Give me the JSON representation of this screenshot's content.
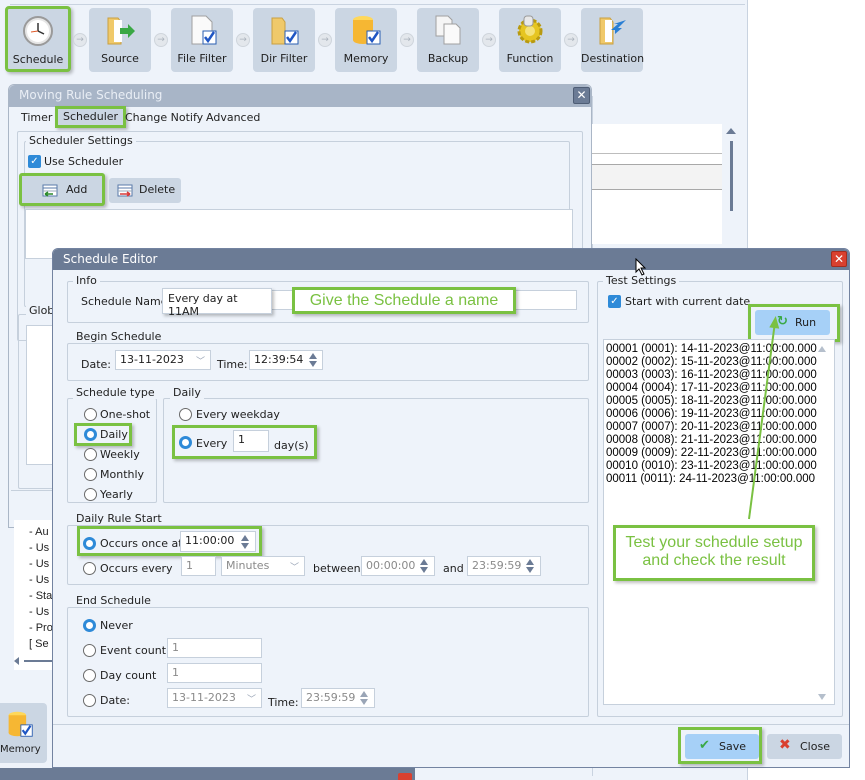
{
  "toolbar": {
    "items": [
      {
        "label": "Schedule",
        "icon": "clock-icon"
      },
      {
        "label": "Source",
        "icon": "folder-arrow-icon"
      },
      {
        "label": "File Filter",
        "icon": "file-check-icon"
      },
      {
        "label": "Dir Filter",
        "icon": "folder-check-icon"
      },
      {
        "label": "Memory",
        "icon": "database-check-icon"
      },
      {
        "label": "Backup",
        "icon": "copy-files-icon"
      },
      {
        "label": "Function",
        "icon": "gear-icon"
      },
      {
        "label": "Destination",
        "icon": "folder-import-icon"
      }
    ],
    "arrow_glyph": "→",
    "bottom_item_label": "Memory"
  },
  "rule_dialog": {
    "title": "Moving Rule Scheduling",
    "close_glyph": "✕",
    "tabs": [
      "Timer",
      "Scheduler",
      "Change Notify",
      "Advanced"
    ],
    "scheduler_settings_title": "Scheduler Settings",
    "use_scheduler_label": "Use Scheduler",
    "use_scheduler_checked": true,
    "add_label": "Add",
    "delete_label": "Delete",
    "global_title": "Globa",
    "partial_list": [
      "- Au",
      "- Us",
      "- Us",
      "- Us",
      "- Sta",
      "- Us",
      "- Pro",
      "[ Se"
    ]
  },
  "editor": {
    "title": "Schedule Editor",
    "close_glyph": "✕",
    "info": {
      "title": "Info",
      "name_label": "Schedule Name:",
      "name_value": "Every day at 11AM"
    },
    "begin": {
      "title": "Begin Schedule",
      "date_label": "Date:",
      "date_value": "13-11-2023",
      "time_label": "Time:",
      "time_value": "12:39:54"
    },
    "schedule_type": {
      "title": "Schedule type",
      "options": [
        "One-shot",
        "Daily",
        "Weekly",
        "Monthly",
        "Yearly"
      ],
      "selected": "Daily"
    },
    "daily": {
      "title": "Daily",
      "every_weekday_label": "Every weekday",
      "every_label": "Every",
      "every_value": "1",
      "days_label": "day(s)",
      "selected": "Every"
    },
    "daily_rule_start": {
      "title": "Daily Rule Start",
      "once_label": "Occurs once at",
      "once_value": "11:00:00",
      "every_label": "Occurs every",
      "every_value": "1",
      "unit_value": "Minutes",
      "between_label": "between",
      "between_value": "00:00:00",
      "and_label": "and",
      "and_value": "23:59:59",
      "selected": "once"
    },
    "end": {
      "title": "End Schedule",
      "never_label": "Never",
      "event_count_label": "Event count",
      "event_count_value": "1",
      "day_count_label": "Day count",
      "day_count_value": "1",
      "date_label": "Date:",
      "date_value": "13-11-2023",
      "time_label": "Time:",
      "time_value": "23:59:59",
      "selected": "Never"
    },
    "test": {
      "title": "Test Settings",
      "start_current_label": "Start with current date",
      "start_current_checked": true,
      "run_label": "Run",
      "results": [
        "00001 (0001): 14-11-2023@11:00:00.000",
        "00002 (0002): 15-11-2023@11:00:00.000",
        "00003 (0003): 16-11-2023@11:00:00.000",
        "00004 (0004): 17-11-2023@11:00:00.000",
        "00005 (0005): 18-11-2023@11:00:00.000",
        "00006 (0006): 19-11-2023@11:00:00.000",
        "00007 (0007): 20-11-2023@11:00:00.000",
        "00008 (0008): 21-11-2023@11:00:00.000",
        "00009 (0009): 22-11-2023@11:00:00.000",
        "00010 (0010): 23-11-2023@11:00:00.000",
        "00011 (0011): 24-11-2023@11:00:00.000"
      ]
    },
    "save_label": "Save",
    "close_label": "Close"
  },
  "callouts": {
    "name": "Give the Schedule a name",
    "test_line1": "Test your schedule setup",
    "test_line2": "and check the result"
  },
  "colors": {
    "highlight": "#7ac142",
    "title_bar": "#6b7b95",
    "accent_blue": "#2e8ad8",
    "close_red": "#d9402f"
  }
}
